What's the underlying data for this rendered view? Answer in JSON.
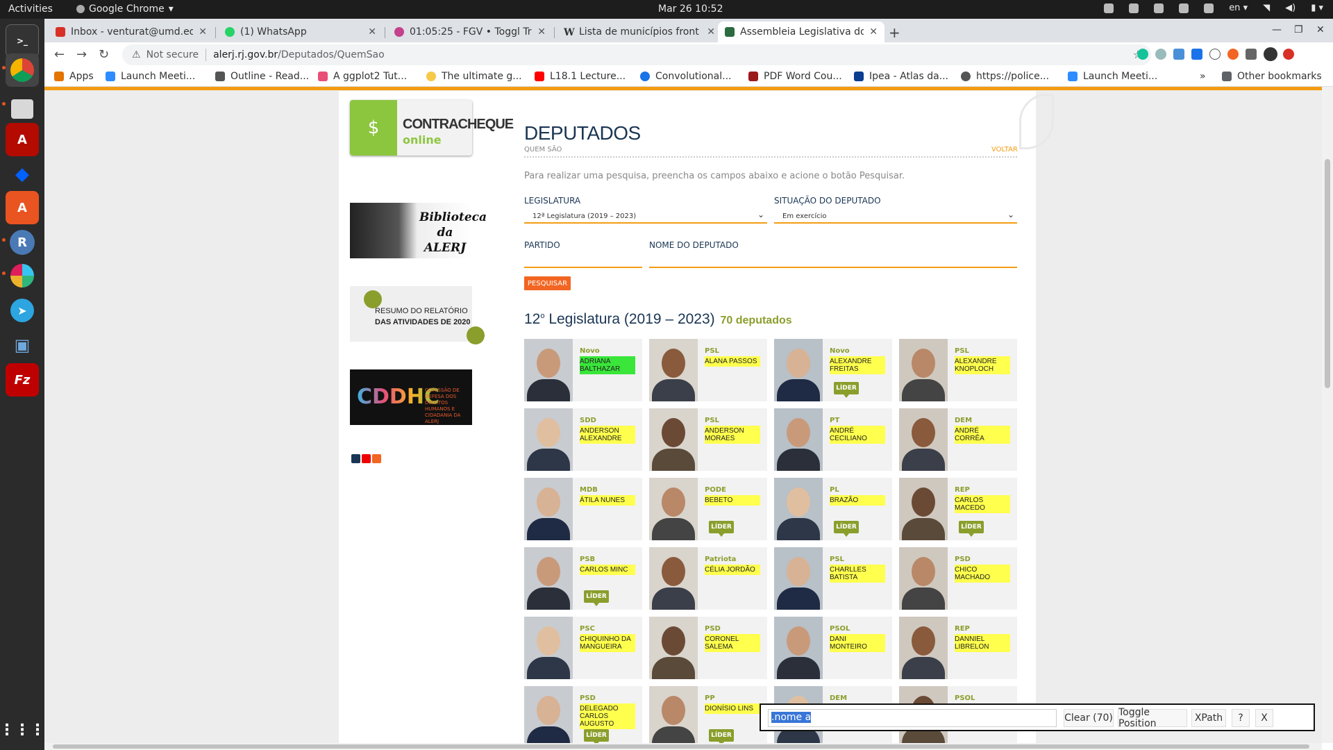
{
  "topbar": {
    "activities": "Activities",
    "app_name": "Google Chrome",
    "clock": "Mar 26  10:52",
    "lang": "en"
  },
  "tabs": [
    {
      "label": "Inbox - venturat@umd.ed",
      "color": "#d93025"
    },
    {
      "label": "(1) WhatsApp",
      "color": "#25d366"
    },
    {
      "label": "01:05:25 - FGV • Toggl Trac",
      "color": "#c5418c"
    },
    {
      "label": "Lista de municípios front",
      "color": "#222222"
    },
    {
      "label": "Assembleia Legislativa do",
      "color": "#2b6b3f"
    }
  ],
  "omnibox": {
    "not_secure": "Not secure",
    "host": "alerj.rj.gov.br",
    "path": "/Deputados/QuemSao"
  },
  "bookmarks": [
    {
      "label": "Apps",
      "color": "#e37400"
    },
    {
      "label": "Launch Meeti...",
      "color": "#2d8cff"
    },
    {
      "label": "Outline - Read...",
      "color": "#555555"
    },
    {
      "label": "A ggplot2 Tut...",
      "color": "#e94e77"
    },
    {
      "label": "The ultimate g...",
      "color": "#f7c948"
    },
    {
      "label": "L18.1 Lecture...",
      "color": "#ff0000"
    },
    {
      "label": "Convolutional...",
      "color": "#1a73e8"
    },
    {
      "label": "PDF Word Cou...",
      "color": "#9b1b1b"
    },
    {
      "label": "Ipea - Atlas da...",
      "color": "#0b3d91"
    },
    {
      "label": "https://police...",
      "color": "#555555"
    },
    {
      "label": "Launch Meeti...",
      "color": "#2d8cff"
    }
  ],
  "other_bookmarks": "Other bookmarks",
  "sidebar": {
    "contracheque_t1": "CONTRACHEQUE",
    "contracheque_t2": "online",
    "biblioteca": "Biblioteca da ALERJ",
    "resumo_l1": "RESUMO DO RELATÓRIO",
    "resumo_l2": "DAS ATIVIDADES DE 2020",
    "cddhc": "CDDHC",
    "cddhc_small": "COMISSÃO DE DEFESA DOS DIREITOS HUMANOS E CIDADANIA DA ALERJ"
  },
  "page": {
    "title": "DEPUTADOS",
    "subtitle": "QUEM SÃO",
    "voltar": "VOLTAR",
    "instructions": "Para realizar uma pesquisa, preencha os campos abaixo e acione o botão Pesquisar.",
    "legislatura_label": "LEGISLATURA",
    "legislatura_value": "12ª Legislatura (2019 – 2023)",
    "situacao_label": "SITUAÇÃO DO DEPUTADO",
    "situacao_value": "Em exercício",
    "partido_label": "PARTIDO",
    "nome_label": "NOME DO DEPUTADO",
    "search_button": "PESQUISAR",
    "legislature_heading_num": "12",
    "legislature_heading_sup": "o",
    "legislature_heading_rest": " Legislatura (2019 – 2023)",
    "legislature_count": "70 deputados"
  },
  "lider_label": "LÍDER",
  "deputies": [
    {
      "party": "Novo",
      "name": "ADRIANA BALTHAZAR",
      "lider": false,
      "selected": true
    },
    {
      "party": "PSL",
      "name": "ALANA PASSOS",
      "lider": false
    },
    {
      "party": "Novo",
      "name": "ALEXANDRE FREITAS",
      "lider": true
    },
    {
      "party": "PSL",
      "name": "ALEXANDRE KNOPLOCH",
      "lider": false
    },
    {
      "party": "SDD",
      "name": "ANDERSON ALEXANDRE",
      "lider": false
    },
    {
      "party": "PSL",
      "name": "ANDERSON MORAES",
      "lider": false
    },
    {
      "party": "PT",
      "name": "ANDRÉ CECILIANO",
      "lider": false
    },
    {
      "party": "DEM",
      "name": "ANDRÉ CORRÊA",
      "lider": false
    },
    {
      "party": "MDB",
      "name": "ÁTILA NUNES",
      "lider": false
    },
    {
      "party": "PODE",
      "name": "BEBETO",
      "lider": true
    },
    {
      "party": "PL",
      "name": "BRAZÃO",
      "lider": true
    },
    {
      "party": "REP",
      "name": "CARLOS MACEDO",
      "lider": true
    },
    {
      "party": "PSB",
      "name": "CARLOS MINC",
      "lider": true
    },
    {
      "party": "Patriota",
      "name": "CÉLIA JORDÃO",
      "lider": false
    },
    {
      "party": "PSL",
      "name": "CHARLLES BATISTA",
      "lider": false
    },
    {
      "party": "PSD",
      "name": "CHICO MACHADO",
      "lider": false
    },
    {
      "party": "PSC",
      "name": "CHIQUINHO DA MANGUEIRA",
      "lider": false
    },
    {
      "party": "PSD",
      "name": "CORONEL SALEMA",
      "lider": false
    },
    {
      "party": "PSOL",
      "name": "DANI MONTEIRO",
      "lider": false
    },
    {
      "party": "REP",
      "name": "DANNIEL LIBRELON",
      "lider": false
    },
    {
      "party": "PSD",
      "name": "DELEGADO CARLOS AUGUSTO",
      "lider": true
    },
    {
      "party": "PP",
      "name": "DIONÍSIO LINS",
      "lider": true
    },
    {
      "party": "DEM",
      "name": "",
      "lider": false
    },
    {
      "party": "PSOL",
      "name": "",
      "lider": false
    }
  ],
  "selector_gadget": {
    "input_value": ".nome a",
    "clear": "Clear (70)",
    "toggle": "Toggle Position",
    "xpath": "XPath",
    "help": "?",
    "close": "X"
  }
}
